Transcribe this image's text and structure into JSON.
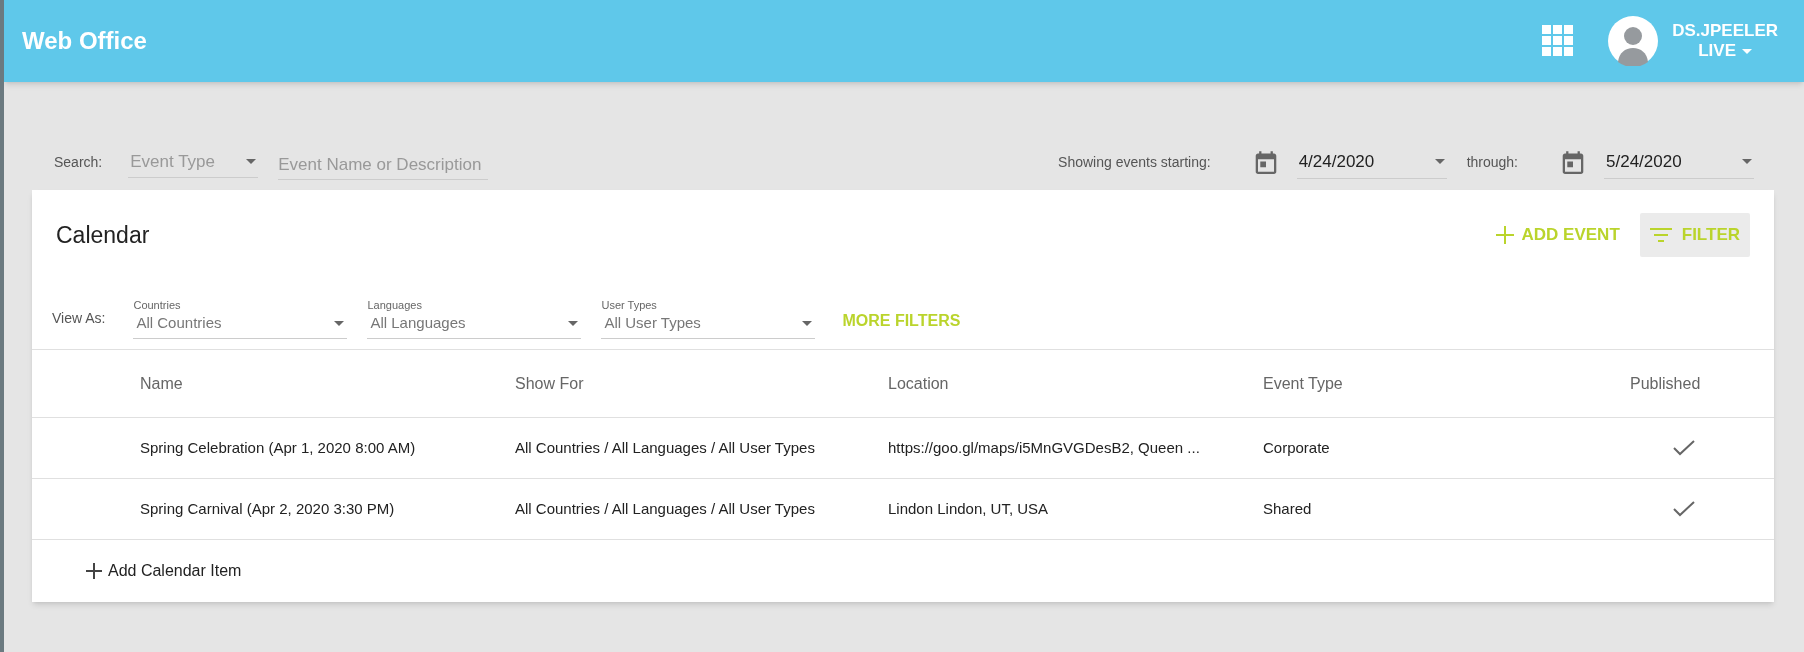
{
  "header": {
    "title": "Web Office",
    "user": {
      "name": "DS.JPEELER",
      "environment": "LIVE"
    }
  },
  "search": {
    "label": "Search:",
    "event_type": {
      "placeholder": "Event Type"
    },
    "query": {
      "placeholder": "Event Name or Description"
    },
    "range_label": "Showing events starting:",
    "start_date": "4/24/2020",
    "through_label": "through:",
    "end_date": "5/24/2020"
  },
  "calendar": {
    "title": "Calendar",
    "add_event": "ADD EVENT",
    "filter": {
      "label": "FILTER",
      "active": true
    },
    "view_as": {
      "label": "View As:",
      "selects": [
        {
          "label": "Countries",
          "value": "All Countries"
        },
        {
          "label": "Languages",
          "value": "All Languages"
        },
        {
          "label": "User Types",
          "value": "All User Types"
        }
      ],
      "more_filters": "MORE FILTERS"
    },
    "table": {
      "columns": [
        "Name",
        "Show For",
        "Location",
        "Event Type",
        "Published"
      ],
      "rows": [
        {
          "name": "Spring Celebration (Apr 1, 2020 8:00 AM)",
          "show_for": "All Countries / All Languages / All User Types",
          "location": "https://goo.gl/maps/i5MnGVGDesB2, Queen ...",
          "event_type": "Corporate",
          "published": true
        },
        {
          "name": "Spring Carnival (Apr 2, 2020 3:30 PM)",
          "show_for": "All Countries / All Languages / All User Types",
          "location": "Lindon Lindon, UT, USA",
          "event_type": "Shared",
          "published": true
        }
      ]
    },
    "add_item": "Add Calendar Item"
  }
}
